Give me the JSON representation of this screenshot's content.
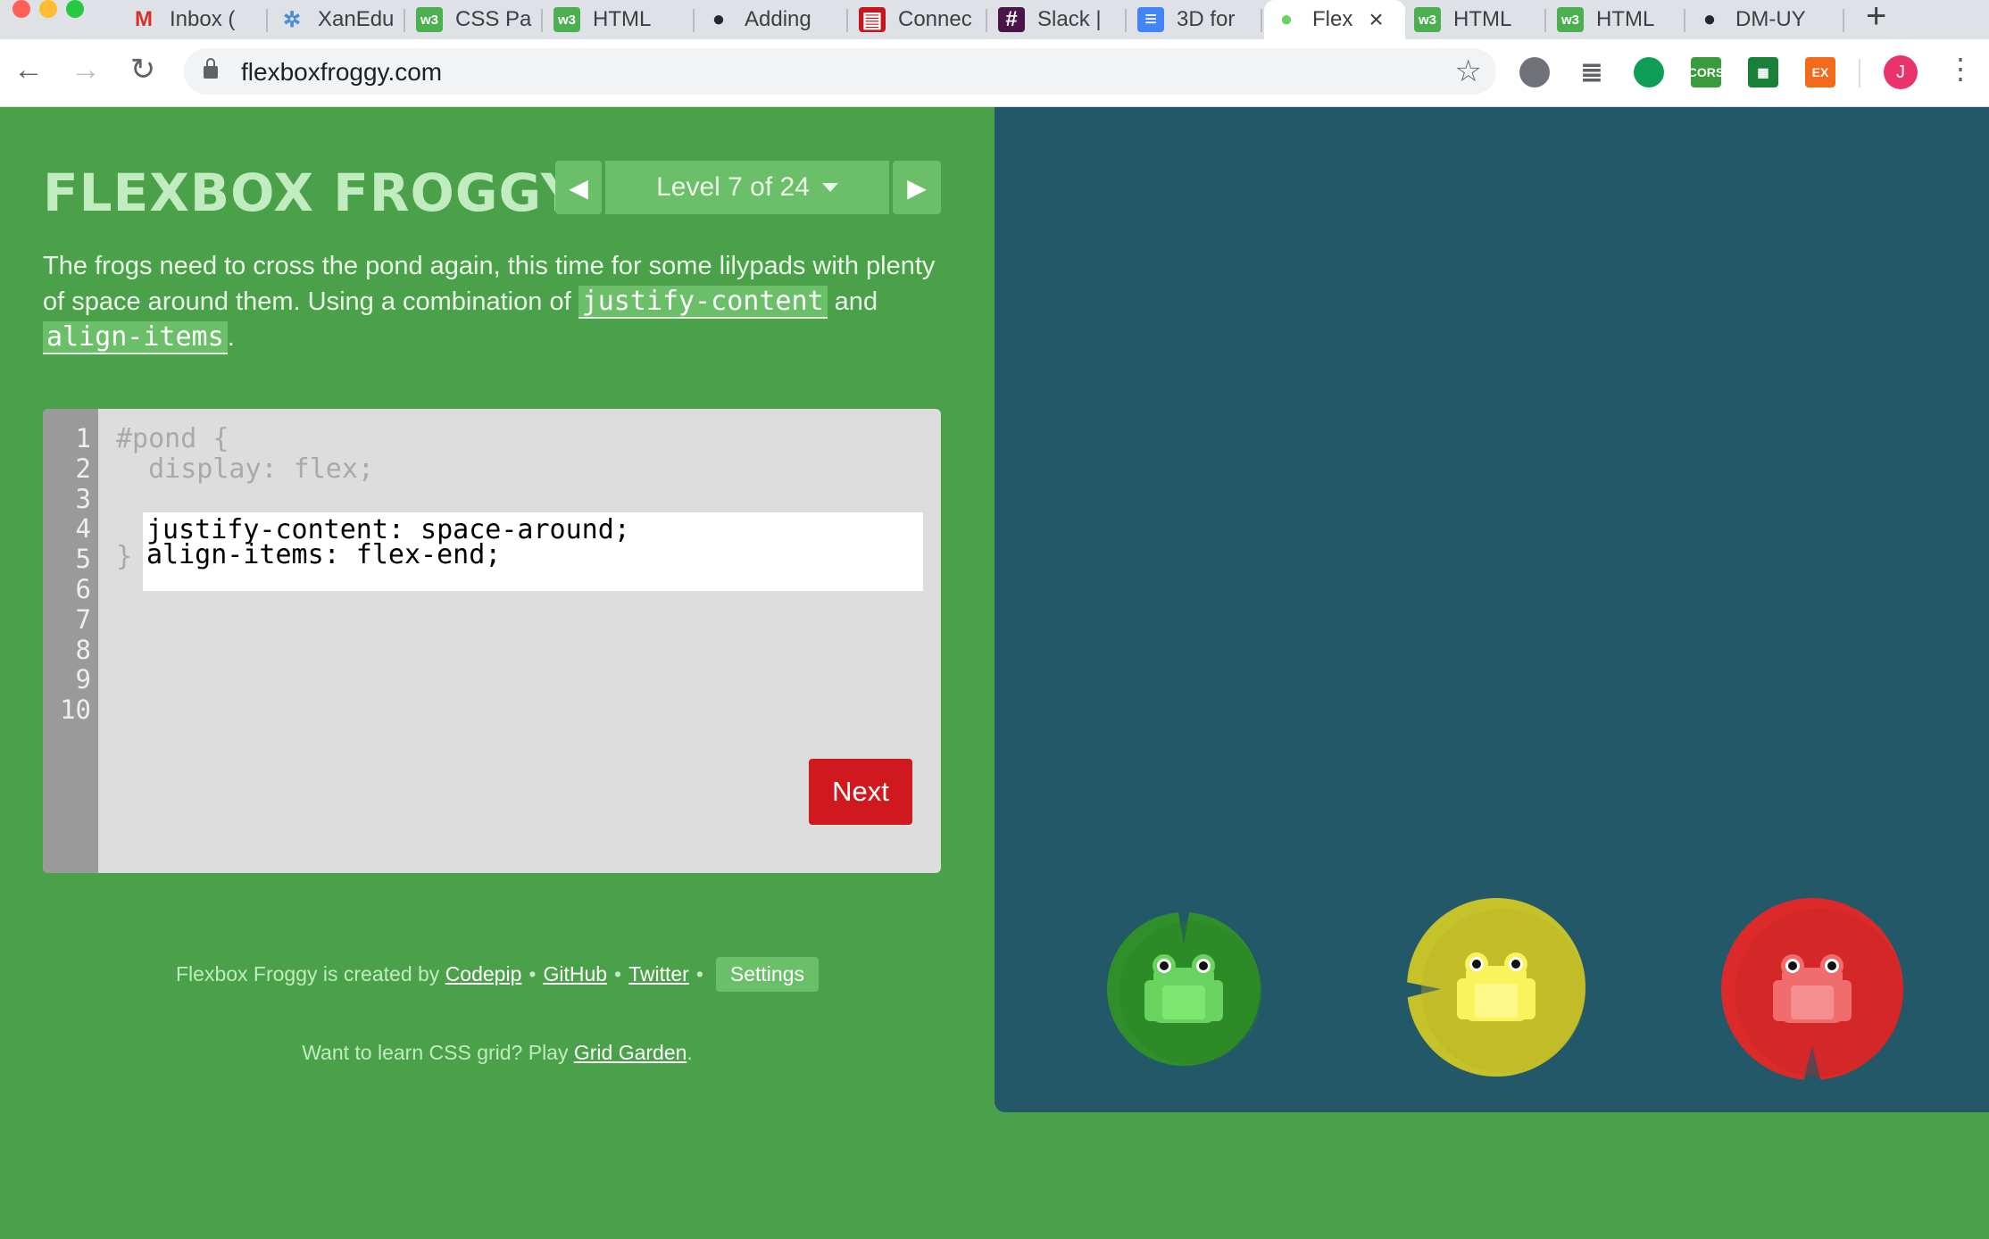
{
  "browser": {
    "tabs": [
      {
        "title": "Inbox (",
        "icon": "gmail-icon",
        "fav": "M",
        "favColor": "#d93025",
        "favBg": "transparent"
      },
      {
        "title": "XanEdu",
        "icon": "xanedu-icon",
        "fav": "✲",
        "favColor": "#4a8fd6",
        "favBg": "transparent"
      },
      {
        "title": "CSS Pa",
        "icon": "w3schools-icon",
        "fav": "w3",
        "favColor": "#ffffff",
        "favBg": "#4caf50"
      },
      {
        "title": "HTML",
        "icon": "w3schools-icon",
        "fav": "w3",
        "favColor": "#ffffff",
        "favBg": "#4caf50"
      },
      {
        "title": "Adding",
        "icon": "github-icon",
        "fav": "●",
        "favColor": "#24292e",
        "favBg": "transparent"
      },
      {
        "title": "Connec",
        "icon": "mcgraw-hill-icon",
        "fav": "▤",
        "favColor": "#ffffff",
        "favBg": "#c4161c"
      },
      {
        "title": "Slack |",
        "icon": "slack-icon",
        "fav": "#",
        "favColor": "#ffffff",
        "favBg": "#4a154b"
      },
      {
        "title": "3D for",
        "icon": "google-docs-icon",
        "fav": "≡",
        "favColor": "#ffffff",
        "favBg": "#4285f4"
      },
      {
        "title": "Flex",
        "icon": "frog-icon",
        "fav": "●",
        "favColor": "#6ad35f",
        "favBg": "transparent",
        "active": true
      },
      {
        "title": "HTML",
        "icon": "w3schools-icon",
        "fav": "w3",
        "favColor": "#ffffff",
        "favBg": "#4caf50"
      },
      {
        "title": "HTML",
        "icon": "w3schools-icon",
        "fav": "w3",
        "favColor": "#ffffff",
        "favBg": "#4caf50"
      },
      {
        "title": "DM-UY",
        "icon": "github-icon",
        "fav": "●",
        "favColor": "#24292e",
        "favBg": "transparent"
      }
    ],
    "url": "flexboxfroggy.com",
    "extensions": [
      {
        "name": "camera-icon",
        "label": "",
        "bg": "#6f7379"
      },
      {
        "name": "list-icon",
        "label": "≣",
        "bg": "transparent"
      },
      {
        "name": "hangouts-icon",
        "label": "",
        "bg": "#0f9d58"
      },
      {
        "name": "cors-extension-icon",
        "label": "CORS",
        "bg": "#3a9b3b"
      },
      {
        "name": "sheets-extension-icon",
        "label": "▦",
        "bg": "#188038"
      },
      {
        "name": "ex-extension-icon",
        "label": "EX",
        "bg": "#f26b1d"
      }
    ],
    "profile_initial": "J",
    "profile_color": "#e8336d"
  },
  "game": {
    "title": "FLEXBOX FROGGY",
    "level_label": "Level 7 of 24",
    "instructions": {
      "text_before": "The frogs need to cross the pond again, this time for some lilypads with plenty of space around them. Using a combination of ",
      "code1": "justify-content",
      "text_mid": " and ",
      "code2": "align-items",
      "text_after": "."
    },
    "editor": {
      "line_numbers": [
        "1",
        "2",
        "3",
        "4",
        "5",
        "6",
        "7",
        "8",
        "9",
        "10"
      ],
      "line1": "#pond {",
      "line2": "  display: flex;",
      "answer_line1": "justify-content: space-around;",
      "answer_line2": "align-items: flex-end;",
      "line5": "}",
      "next_label": "Next"
    },
    "credits": {
      "text": "Flexbox Froggy is created by ",
      "codepip": "Codepip",
      "github": "GitHub",
      "twitter": "Twitter",
      "settings": "Settings",
      "grid_text": "Want to learn CSS grid? Play ",
      "grid_link": "Grid Garden",
      "grid_end": "."
    },
    "colors": {
      "background": "#4aa149",
      "pond": "#235868",
      "frog_green": "#6ad35f",
      "frog_yellow": "#f9f45c",
      "frog_red": "#f16c6c",
      "next_button": "#d0191f"
    },
    "lilypads": [
      {
        "color": "green",
        "pad_fill": "#2f8f2a",
        "pad_dark": "#278223",
        "frog": "#6ad35f",
        "frog_belly": "#7ce870"
      },
      {
        "color": "yellow",
        "pad_fill": "#c6c22a",
        "pad_dark": "#b6b221",
        "frog": "#f9f45c",
        "frog_belly": "#fff98a"
      },
      {
        "color": "red",
        "pad_fill": "#dc2a2a",
        "pad_dark": "#c62222",
        "frog": "#f16c6c",
        "frog_belly": "#f58f8f"
      }
    ]
  }
}
